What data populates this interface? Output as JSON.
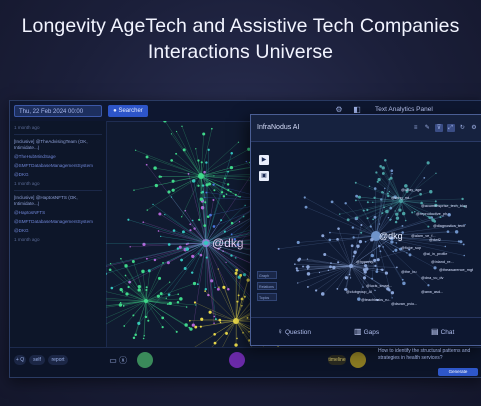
{
  "title": {
    "line1": "Longevity AgeTech and Assistive Tech Companies",
    "line2": "Interactions Universe"
  },
  "toolbar": {
    "date_value": "Thu, 22 Feb 2024 00:00",
    "live_button": "● Searcher",
    "panel_title": "Text Analytics Panel"
  },
  "feed": {
    "posts": [
      {
        "time": "1 month ago"
      },
      {
        "header": "[Inclusive] @TheAdvisingTeam (OK, Intimidate...)",
        "mention": "@TheHubMindSage",
        "handle": "@SMFTDatabaseManagementSystem",
        "tag": "@DKG",
        "time": "1 month ago"
      },
      {
        "header": "[Inclusive] @HaptosNFTS (OK, Intimidate...)",
        "mention": "@HaptosNFTS",
        "handle": "@SMFTDatabaseManagementSystem",
        "tag": "@DKG",
        "time": "1 month ago"
      }
    ]
  },
  "graph": {
    "center_label": "@dkg",
    "colors": {
      "green": "#3fd88a",
      "teal": "#35c6c0",
      "purple": "#b465d8",
      "yellow": "#e8d84a",
      "blue": "#4a79e0"
    }
  },
  "overlay": {
    "title": "InfraNodus AI",
    "center_label": "@dkg",
    "node_labels": [
      "@dnay_age",
      "@wing_mt...",
      "@acumensprise_tech_blog",
      "@reproductive_ph...",
      "@diagnostics_tech",
      "@alam_ve_f...",
      "@dwf2",
      "@fiche_sup",
      "@ai_in_profile",
      "@inland_re...",
      "@hypersy...",
      "@theawarence_mgt",
      "@the_bu",
      "@dna_vu_dv",
      "@lucis_smart...",
      "@clubgroup_AI",
      "@anw_asd...",
      "@teachleaks_ru..",
      "@dsvan_pvio..."
    ],
    "list_items": [
      "Graph",
      "Relations",
      "Topics"
    ],
    "tabs": {
      "question": "Question",
      "gaps": "Gaps",
      "chat": "Chat"
    }
  },
  "bottombar": {
    "pill1": "+ Q",
    "pill2": "self",
    "pill3": "report",
    "timeline_label": "timeline"
  },
  "below": {
    "text": "How to identify the structural patterns and strategies in health services?",
    "button": "Generate"
  }
}
